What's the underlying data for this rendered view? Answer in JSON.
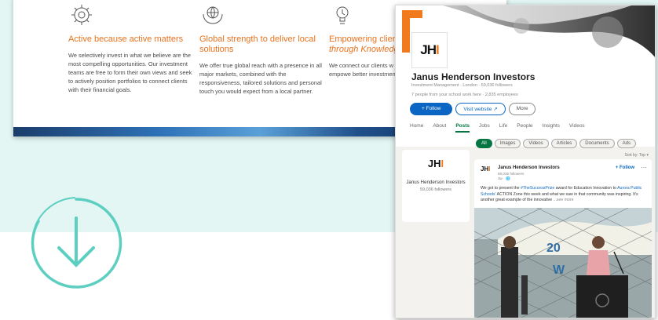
{
  "site": {
    "columns": [
      {
        "icon": "gear-people-icon",
        "title": "Active because active matters",
        "body": "We selectively invest in what we believe are the most compelling opportunities. Our investment teams are free to form their own views and seek to actively position portfolios to connect clients with their financial goals."
      },
      {
        "icon": "globe-hands-icon",
        "title": "Global strength to deliver local solutions",
        "body": "We offer true global reach with a presence in all major markets, combined with the responsiveness, tailored solutions and personal touch you would expect from a local partner."
      },
      {
        "icon": "lightbulb-icon",
        "title_prefix": "Empowering client",
        "title_suffix": "through Knowledge",
        "body": "We connect our clients w knowledge that empowe better investment and bu"
      }
    ]
  },
  "linkedin": {
    "logo": "JHI",
    "company_name": "Janus Henderson Investors",
    "subtitle": "Investment Management · London · 59,036 followers",
    "connections": "7 people from your school work here · 2,835 employees",
    "buttons": {
      "follow": "+ Follow",
      "website": "Visit website ↗",
      "more": "More"
    },
    "nav": [
      "Home",
      "About",
      "Posts",
      "Jobs",
      "Life",
      "People",
      "Insights",
      "Videos"
    ],
    "nav_active": "Posts",
    "sidebar": {
      "name": "Janus Henderson Investors",
      "followers": "59,036 followers"
    },
    "filters": [
      "All",
      "Images",
      "Videos",
      "Articles",
      "Documents",
      "Ads"
    ],
    "filter_active": "All",
    "sort": "Sort by: Top ▾",
    "post": {
      "author": "Janus Henderson Investors",
      "followers": "59,036 followers",
      "time": "3w · 🌐",
      "follow": "+ Follow",
      "more": "···",
      "text_a": "We got to present the ",
      "tag": "#TheSuccessPrize",
      "text_b": " award for Education Innovation to ",
      "org": "Aurora Public Schools'",
      "text_c": " ACTION Zone this week and what we saw in that community was inspiring. It's another great example of the innovative",
      "see_more": "...see more"
    }
  },
  "colors": {
    "orange": "#e8731f",
    "teal": "#5ccfc0",
    "linkedin_blue": "#0a66c2",
    "green": "#057642"
  }
}
